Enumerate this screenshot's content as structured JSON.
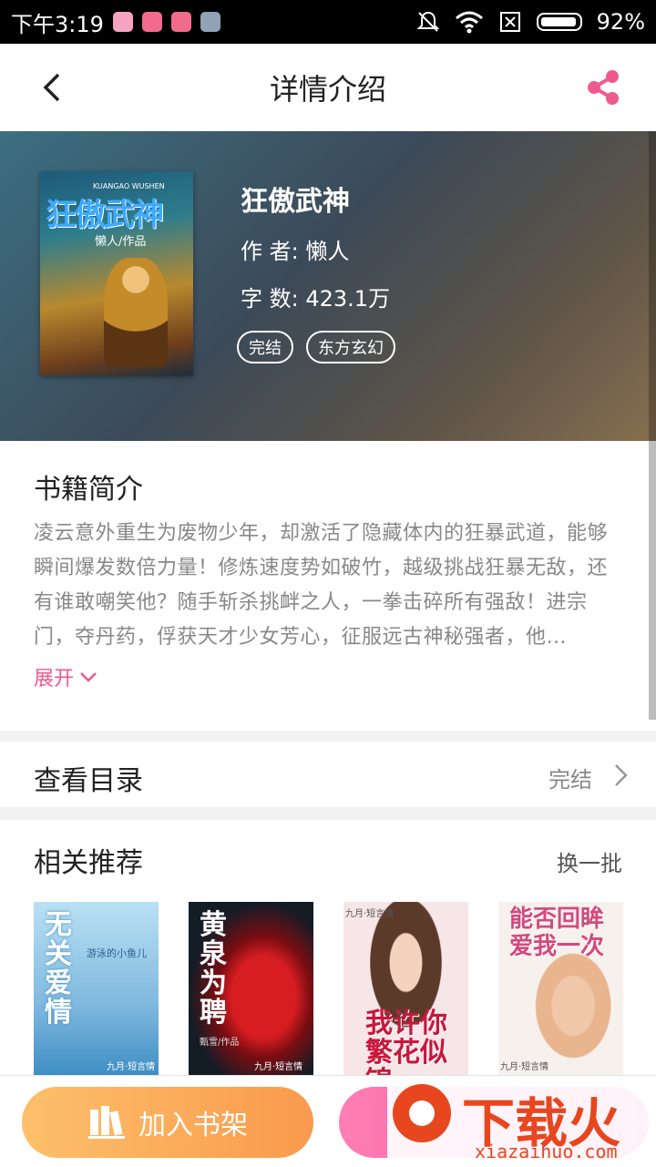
{
  "status_bar": {
    "time": "下午3:19",
    "battery": "92%"
  },
  "nav": {
    "title": "详情介绍"
  },
  "book": {
    "title": "狂傲武神",
    "author_label": "作 者:",
    "author": "懒人",
    "words_label": "字 数:",
    "words": "423.1万",
    "tags": [
      "完结",
      "东方玄幻"
    ],
    "cover": {
      "title_art": "狂傲武神",
      "pinyin": "KUANGAO WUSHEN",
      "author_art": "懒人/作品"
    }
  },
  "intro": {
    "heading": "书籍简介",
    "text": "凌云意外重生为废物少年，却激活了隐藏体内的狂暴武道，能够瞬间爆发数倍力量！修炼速度势如破竹，越级挑战狂暴无敌，还有谁敢嘲笑他？随手斩杀挑衅之人，一拳击碎所有强敌！进宗门，夺丹药，俘获天才少女芳心，征服远古神秘强者，他…",
    "expand": "展开"
  },
  "catalog": {
    "label": "查看目录",
    "status": "完结"
  },
  "recommend": {
    "heading": "相关推荐",
    "more": "换一批",
    "books": [
      {
        "title_art": "无关爱情",
        "sub": "游泳的小鱼儿",
        "publisher": "九月·短言情",
        "colors": [
          "#9fd3ef",
          "#3f8ec4"
        ]
      },
      {
        "title_art": "黄泉为聘",
        "sub": "甄雪/作品",
        "publisher": "九月·短言情",
        "colors": [
          "#16202a",
          "#b3171c"
        ]
      },
      {
        "title_art": "我许你繁花似锦",
        "sub": "",
        "publisher": "九月·短言情",
        "colors": [
          "#f6e6e8",
          "#e0a6a8"
        ]
      },
      {
        "title_art": "能否回眸爱我一次",
        "sub": "",
        "publisher": "九月·短言情",
        "colors": [
          "#f7f1ee",
          "#e9c9b6"
        ]
      }
    ]
  },
  "bottom": {
    "add_shelf": "加入书架"
  },
  "watermark": {
    "text": "下载火",
    "url": "xiazaihuo.com"
  },
  "colors": {
    "accent_pink": "#ef5a8e",
    "accent_orange": "#f99a4d"
  }
}
